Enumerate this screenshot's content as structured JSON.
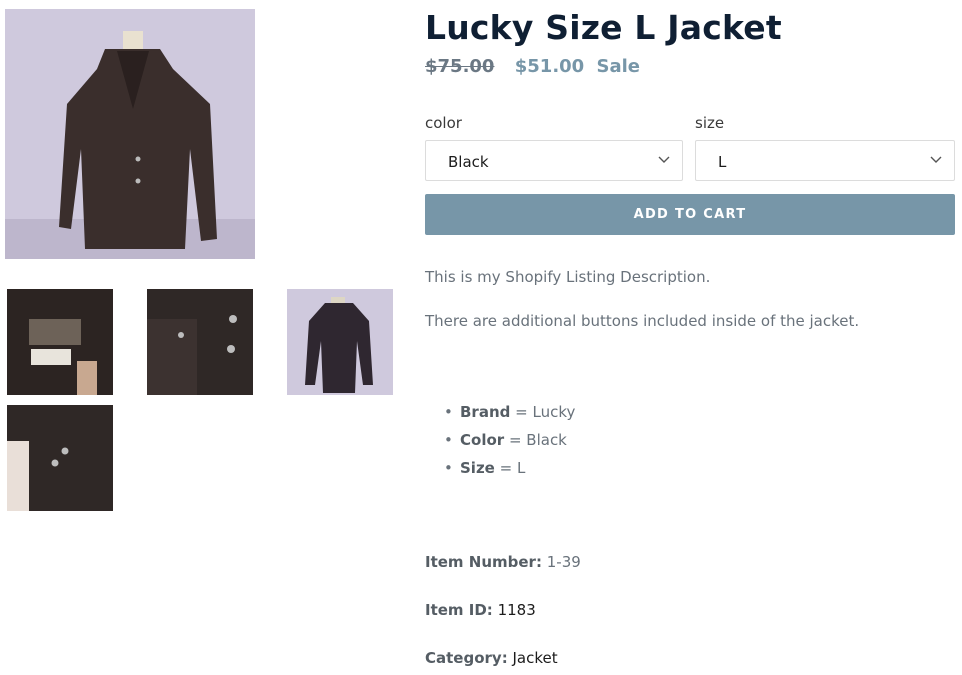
{
  "product": {
    "title": "Lucky Size L Jacket",
    "price_original": "$75.00",
    "price_sale": "$51.00",
    "sale_badge": "Sale"
  },
  "options": {
    "color": {
      "label": "color",
      "value": "Black"
    },
    "size": {
      "label": "size",
      "value": "L"
    }
  },
  "cart": {
    "label": "ADD TO CART"
  },
  "description": {
    "line1": "This is my Shopify Listing Description.",
    "line2": "There are additional buttons included inside of the jacket."
  },
  "specs": [
    {
      "key": "Brand",
      "value": "= Lucky"
    },
    {
      "key": "Color",
      "value": "= Black"
    },
    {
      "key": "Size",
      "value": "= L"
    }
  ],
  "meta": {
    "item_number_label": "Item Number:",
    "item_number": "1-39",
    "item_id_label": "Item ID:",
    "item_id": "1183",
    "category_label": "Category:",
    "category": "Jacket"
  },
  "colors": {
    "accent": "#7796a8",
    "title": "#0f1f33",
    "body_text": "#69727b"
  },
  "icons": {
    "select_arrow": "chevron-down-icon"
  }
}
